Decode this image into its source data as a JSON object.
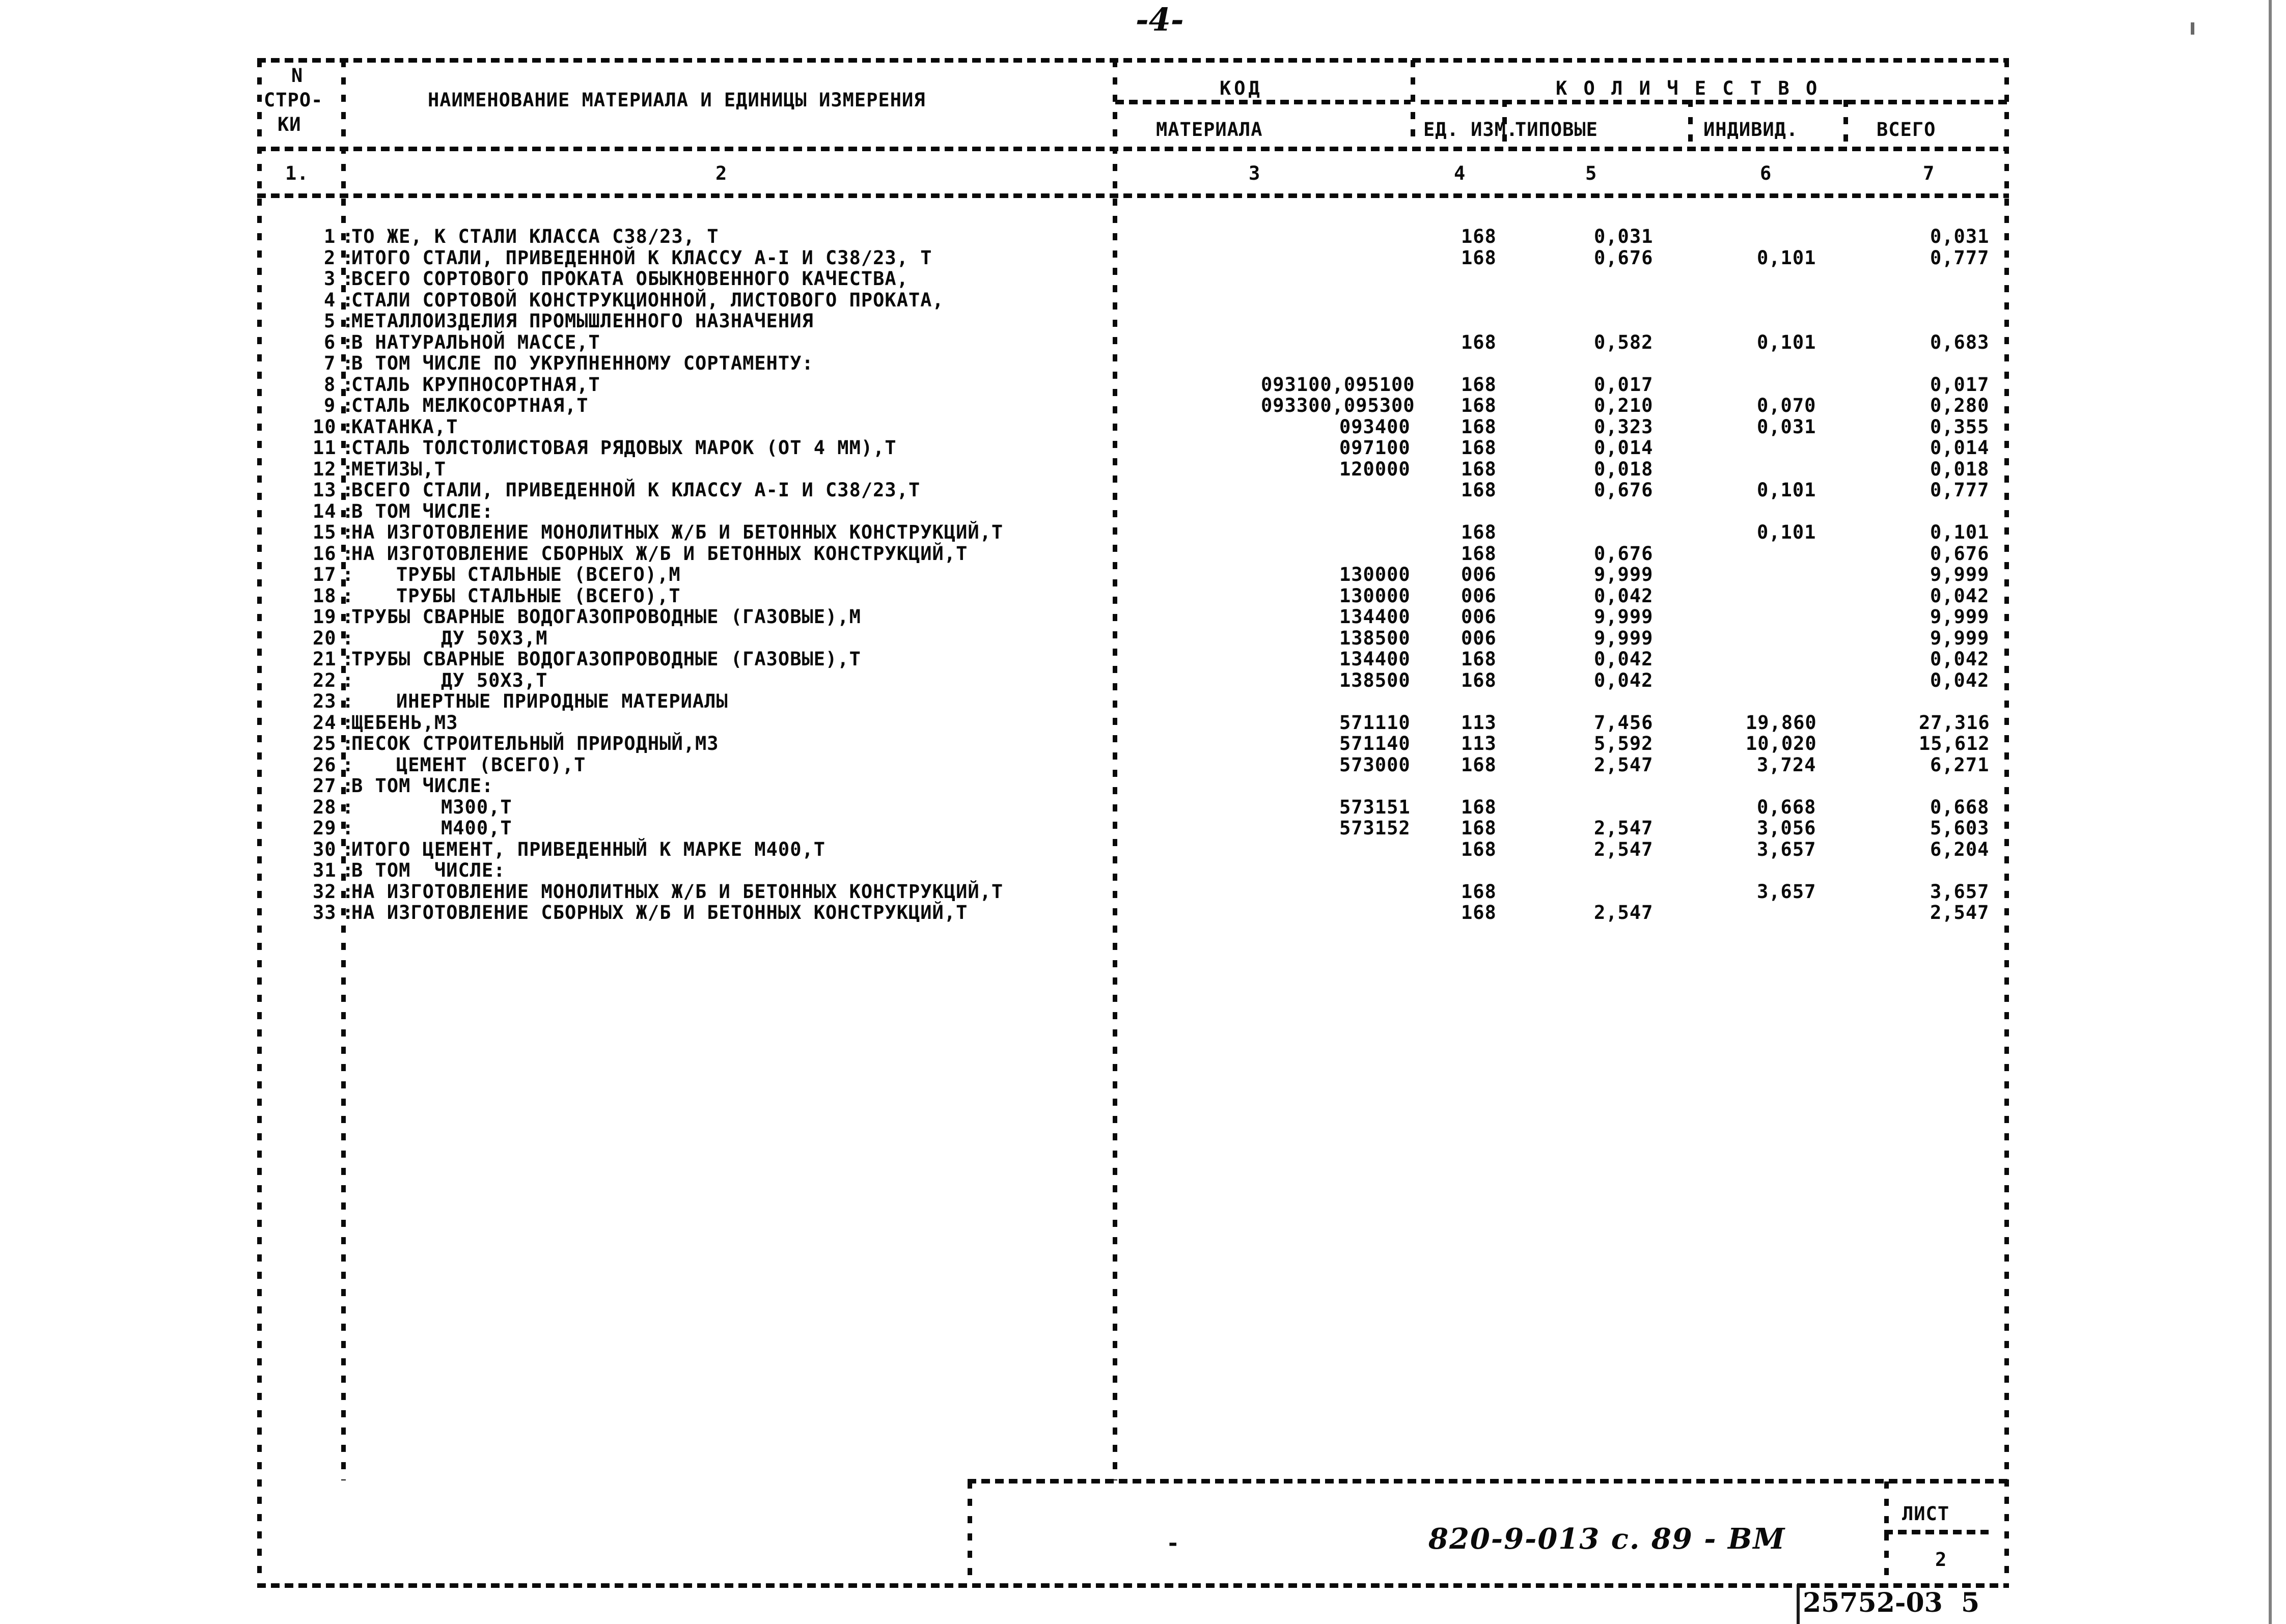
{
  "page": {
    "page_number_handwritten": "-4-",
    "bottom_stamp_handwritten": "25752-03  5",
    "footer_code_handwritten": "820-9-013 с. 89 - ВМ",
    "footer_dash": "-"
  },
  "table": {
    "header": {
      "col1_line1": "N",
      "col1_line2": "СТРО-",
      "col1_line3": "КИ",
      "col2": "НАИМЕНОВАНИЕ МАТЕРИАЛА И ЕДИНИЦЫ ИЗМЕРЕНИЯ",
      "col3_group": "КОД",
      "col3": "МАТЕРИАЛА",
      "col4": "ЕД. ИЗМ.",
      "quantity_group": "К О Л И Ч Е С Т В О",
      "col5": "ТИПОВЫЕ",
      "col6": "ИНДИВИД.",
      "col7": "ВСЕГО"
    },
    "column_numbers": [
      "1.",
      "2",
      "3",
      "4",
      "5",
      "6",
      "7"
    ],
    "rows": [
      {
        "n": "1",
        "name": "ТО ЖЕ, К СТАЛИ КЛАССА С38/23, Т",
        "indent": 0,
        "code": "",
        "unit": "168",
        "typ": "0,031",
        "ind": "",
        "tot": "0,031"
      },
      {
        "n": "2",
        "name": "ИТОГО СТАЛИ, ПРИВЕДЕННОЙ К КЛАССУ А-I И С38/23, Т",
        "indent": 0,
        "code": "",
        "unit": "168",
        "typ": "0,676",
        "ind": "0,101",
        "tot": "0,777"
      },
      {
        "n": "3",
        "name": "ВСЕГО СОРТОВОГО ПРОКАТА ОБЫКНОВЕННОГО КАЧЕСТВА,",
        "indent": 0,
        "code": "",
        "unit": "",
        "typ": "",
        "ind": "",
        "tot": ""
      },
      {
        "n": "4",
        "name": "СТАЛИ СОРТОВОЙ КОНСТРУКЦИОННОЙ, ЛИСТОВОГО ПРОКАТА,",
        "indent": 0,
        "code": "",
        "unit": "",
        "typ": "",
        "ind": "",
        "tot": ""
      },
      {
        "n": "5",
        "name": "МЕТАЛЛОИЗДЕЛИЯ ПРОМЫШЛЕННОГО НАЗНАЧЕНИЯ",
        "indent": 0,
        "code": "",
        "unit": "",
        "typ": "",
        "ind": "",
        "tot": ""
      },
      {
        "n": "6",
        "name": "В НАТУРАЛЬНОЙ МАССЕ,Т",
        "indent": 0,
        "code": "",
        "unit": "168",
        "typ": "0,582",
        "ind": "0,101",
        "tot": "0,683"
      },
      {
        "n": "7",
        "name": "В ТОМ ЧИСЛЕ ПО УКРУПНЕННОМУ СОРТАМЕНТУ:",
        "indent": 0,
        "code": "",
        "unit": "",
        "typ": "",
        "ind": "",
        "tot": ""
      },
      {
        "n": "8",
        "name": "СТАЛЬ КРУПНОСОРТНАЯ,Т",
        "indent": 0,
        "code": "093100,095100",
        "unit": "168",
        "typ": "0,017",
        "ind": "",
        "tot": "0,017"
      },
      {
        "n": "9",
        "name": "СТАЛЬ МЕЛКОСОРТНАЯ,Т",
        "indent": 0,
        "code": "093300,095300",
        "unit": "168",
        "typ": "0,210",
        "ind": "0,070",
        "tot": "0,280"
      },
      {
        "n": "10",
        "name": "КАТАНКА,Т",
        "indent": 0,
        "code": "093400",
        "unit": "168",
        "typ": "0,323",
        "ind": "0,031",
        "tot": "0,355"
      },
      {
        "n": "11",
        "name": "СТАЛЬ ТОЛСТОЛИСТОВАЯ РЯДОВЫХ МАРОК (ОТ 4 ММ),Т",
        "indent": 0,
        "code": "097100",
        "unit": "168",
        "typ": "0,014",
        "ind": "",
        "tot": "0,014"
      },
      {
        "n": "12",
        "name": "МЕТИЗЫ,Т",
        "indent": 0,
        "code": "120000",
        "unit": "168",
        "typ": "0,018",
        "ind": "",
        "tot": "0,018"
      },
      {
        "n": "13",
        "name": "ВСЕГО СТАЛИ, ПРИВЕДЕННОЙ К КЛАССУ А-I И С38/23,Т",
        "indent": 0,
        "code": "",
        "unit": "168",
        "typ": "0,676",
        "ind": "0,101",
        "tot": "0,777"
      },
      {
        "n": "14",
        "name": "В ТОМ ЧИСЛЕ:",
        "indent": 0,
        "code": "",
        "unit": "",
        "typ": "",
        "ind": "",
        "tot": ""
      },
      {
        "n": "15",
        "name": "НА ИЗГОТОВЛЕНИЕ МОНОЛИТНЫХ Ж/Б И БЕТОННЫХ КОНСТРУКЦИЙ,Т",
        "indent": 0,
        "code": "",
        "unit": "168",
        "typ": "",
        "ind": "0,101",
        "tot": "0,101"
      },
      {
        "n": "16",
        "name": "НА ИЗГОТОВЛЕНИЕ СБОРНЫХ Ж/Б И БЕТОННЫХ КОНСТРУКЦИЙ,Т",
        "indent": 0,
        "code": "",
        "unit": "168",
        "typ": "0,676",
        "ind": "",
        "tot": "0,676"
      },
      {
        "n": "17",
        "name": "ТРУБЫ СТАЛЬНЫЕ (ВСЕГО),М",
        "indent": 4,
        "code": "130000",
        "unit": "006",
        "typ": "9,999",
        "ind": "",
        "tot": "9,999"
      },
      {
        "n": "18",
        "name": "ТРУБЫ СТАЛЬНЫЕ (ВСЕГО),Т",
        "indent": 4,
        "code": "130000",
        "unit": "006",
        "typ": "0,042",
        "ind": "",
        "tot": "0,042"
      },
      {
        "n": "19",
        "name": "ТРУБЫ СВАРНЫЕ ВОДОГАЗОПРОВОДНЫЕ (ГАЗОВЫЕ),М",
        "indent": 0,
        "code": "134400",
        "unit": "006",
        "typ": "9,999",
        "ind": "",
        "tot": "9,999"
      },
      {
        "n": "20",
        "name": "ДУ 50Х3,М",
        "indent": 8,
        "code": "138500",
        "unit": "006",
        "typ": "9,999",
        "ind": "",
        "tot": "9,999"
      },
      {
        "n": "21",
        "name": "ТРУБЫ СВАРНЫЕ ВОДОГАЗОПРОВОДНЫЕ (ГАЗОВЫЕ),Т",
        "indent": 0,
        "code": "134400",
        "unit": "168",
        "typ": "0,042",
        "ind": "",
        "tot": "0,042"
      },
      {
        "n": "22",
        "name": "ДУ 50Х3,Т",
        "indent": 8,
        "code": "138500",
        "unit": "168",
        "typ": "0,042",
        "ind": "",
        "tot": "0,042"
      },
      {
        "n": "23",
        "name": "ИНЕРТНЫЕ ПРИРОДНЫЕ МАТЕРИАЛЫ",
        "indent": 4,
        "code": "",
        "unit": "",
        "typ": "",
        "ind": "",
        "tot": ""
      },
      {
        "n": "24",
        "name": "ЩЕБЕНЬ,М3",
        "indent": 0,
        "code": "571110",
        "unit": "113",
        "typ": "7,456",
        "ind": "19,860",
        "tot": "27,316"
      },
      {
        "n": "25",
        "name": "ПЕСОК СТРОИТЕЛЬНЫЙ ПРИРОДНЫЙ,М3",
        "indent": 0,
        "code": "571140",
        "unit": "113",
        "typ": "5,592",
        "ind": "10,020",
        "tot": "15,612"
      },
      {
        "n": "26",
        "name": "ЦЕМЕНТ (ВСЕГО),Т",
        "indent": 4,
        "code": "573000",
        "unit": "168",
        "typ": "2,547",
        "ind": "3,724",
        "tot": "6,271"
      },
      {
        "n": "27",
        "name": "В ТОМ ЧИСЛЕ:",
        "indent": 0,
        "code": "",
        "unit": "",
        "typ": "",
        "ind": "",
        "tot": ""
      },
      {
        "n": "28",
        "name": "М300,Т",
        "indent": 8,
        "code": "573151",
        "unit": "168",
        "typ": "",
        "ind": "0,668",
        "tot": "0,668"
      },
      {
        "n": "29",
        "name": "М400,Т",
        "indent": 8,
        "code": "573152",
        "unit": "168",
        "typ": "2,547",
        "ind": "3,056",
        "tot": "5,603"
      },
      {
        "n": "30",
        "name": "ИТОГО ЦЕМЕНТ, ПРИВЕДЕННЫЙ К МАРКЕ М400,Т",
        "indent": 0,
        "code": "",
        "unit": "168",
        "typ": "2,547",
        "ind": "3,657",
        "tot": "6,204"
      },
      {
        "n": "31",
        "name": "В ТОМ  ЧИСЛЕ:",
        "indent": 0,
        "code": "",
        "unit": "",
        "typ": "",
        "ind": "",
        "tot": ""
      },
      {
        "n": "32",
        "name": "НА ИЗГОТОВЛЕНИЕ МОНОЛИТНЫХ Ж/Б И БЕТОННЫХ КОНСТРУКЦИЙ,Т",
        "indent": 0,
        "code": "",
        "unit": "168",
        "typ": "",
        "ind": "3,657",
        "tot": "3,657"
      },
      {
        "n": "33",
        "name": "НА ИЗГОТОВЛЕНИЕ СБОРНЫХ Ж/Б И БЕТОННЫХ КОНСТРУКЦИЙ,Т",
        "indent": 0,
        "code": "",
        "unit": "168",
        "typ": "2,547",
        "ind": "",
        "tot": "2,547"
      }
    ]
  },
  "footer": {
    "sheet_label": "ЛИСТ",
    "sheet_number": "2"
  }
}
